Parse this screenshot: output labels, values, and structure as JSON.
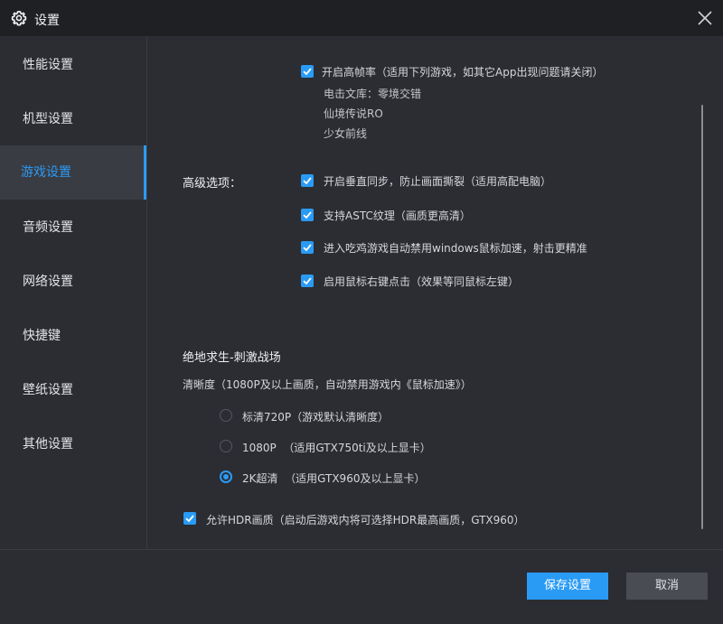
{
  "window": {
    "title": "设置",
    "icons": {
      "settings": "gear-icon",
      "close": "close-icon"
    }
  },
  "sidebar": {
    "items": [
      {
        "label": "性能设置"
      },
      {
        "label": "机型设置"
      },
      {
        "label": "游戏设置",
        "active": true
      },
      {
        "label": "音频设置"
      },
      {
        "label": "网络设置"
      },
      {
        "label": "快捷键"
      },
      {
        "label": "壁纸设置"
      },
      {
        "label": "其他设置"
      }
    ]
  },
  "game": {
    "high_fps": {
      "label": "开启高帧率（适用下列游戏，如其它App出现问题请关闭）",
      "checked": true,
      "games": [
        "电击文库：零境交错",
        "仙境传说RO",
        "少女前线"
      ]
    },
    "advanced": {
      "title": "高级选项：",
      "options": [
        {
          "label": "开启垂直同步，防止画面撕裂（适用高配电脑）",
          "checked": true
        },
        {
          "label": "支持ASTC纹理（画质更高清）",
          "checked": true
        },
        {
          "label": "进入吃鸡游戏自动禁用windows鼠标加速，射击更精准",
          "checked": true
        },
        {
          "label": "启用鼠标右键点击（效果等同鼠标左键）",
          "checked": true
        }
      ]
    },
    "pubg": {
      "title": "绝地求生-刺激战场",
      "resolution_label": "清晰度（1080P及以上画质，自动禁用游戏内《鼠标加速》）",
      "options": [
        {
          "label": "标清720P（游戏默认清晰度）",
          "checked": false
        },
        {
          "label": "1080P  （适用GTX750ti及以上显卡）",
          "checked": false
        },
        {
          "label": "2K超清  （适用GTX960及以上显卡）",
          "checked": true
        }
      ],
      "hdr": {
        "label": "允许HDR画质（启动后游戏内将可选择HDR最高画质，GTX960）",
        "checked": true
      }
    }
  },
  "footer": {
    "save_label": "保存设置",
    "cancel_label": "取消"
  },
  "colors": {
    "accent": "#2a9bf5",
    "background": "#2b2d33",
    "titlebar": "#1f2024"
  }
}
